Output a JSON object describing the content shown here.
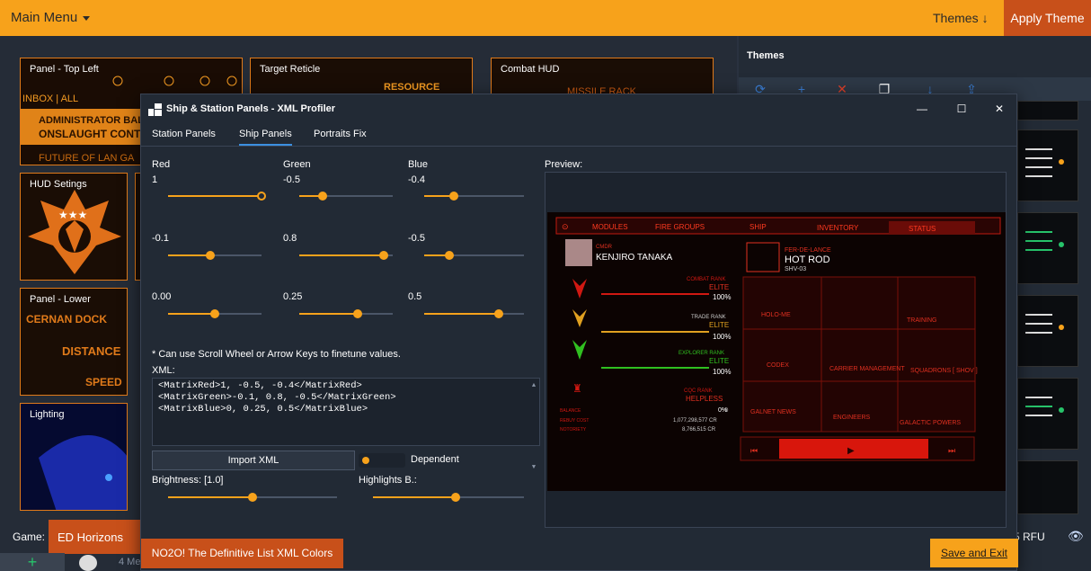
{
  "topbar": {
    "main_menu": "Main Menu",
    "themes": "Themes",
    "apply_theme": "Apply Theme"
  },
  "tiles": [
    {
      "label": "Panel - Top Left",
      "art_text": [
        "INBOX | ALL",
        "ADMINISTRATOR BALDI",
        "ONSLAUGHT CONT",
        "FUTURE OF LAN GA"
      ]
    },
    {
      "label": "Target Reticle",
      "art_text": [
        "RESOURCE"
      ]
    },
    {
      "label": "Combat HUD",
      "art_text": [
        "MISSILE RACK"
      ]
    },
    {
      "label": "HUD Setings"
    },
    {
      "label": "Panel - Lower",
      "art_text": [
        "CERNAN DOCK",
        "DISTANCE",
        "SPEED"
      ]
    },
    {
      "label": "Lighting"
    }
  ],
  "right_panel": {
    "title": "Themes"
  },
  "bottom": {
    "game_label": "Game:",
    "game_value": "ED Horizons",
    "rfu_text": "5 RFU",
    "add_label": "+",
    "mod_text": "4 Me"
  },
  "dialog": {
    "title": "Ship & Station Panels - XML Profiler",
    "tabs": [
      "Station Panels",
      "Ship Panels",
      "Portraits Fix"
    ],
    "active_tab": "Ship Panels",
    "channels": [
      "Red",
      "Green",
      "Blue"
    ],
    "matrix": {
      "red": [
        "1",
        "-0.5",
        "-0.4"
      ],
      "green": [
        "-0.1",
        "0.8",
        "-0.5"
      ],
      "blue": [
        "0.00",
        "0.25",
        "0.5"
      ]
    },
    "matrix_values": {
      "red": [
        1,
        -0.5,
        -0.4
      ],
      "green": [
        -0.1,
        0.8,
        -0.5
      ],
      "blue": [
        0.0,
        0.25,
        0.5
      ]
    },
    "hint": "* Can use Scroll Wheel or Arrow Keys to finetune values.",
    "xml_label": "XML:",
    "xml_lines": [
      "<MatrixRed>1, -0.5, -0.4</MatrixRed>",
      "<MatrixGreen>-0.1, 0.8, -0.5</MatrixGreen>",
      "<MatrixBlue>0, 0.25, 0.5</MatrixBlue>"
    ],
    "import_button": "Import XML",
    "dependent_label": "Dependent",
    "brightness_label": "Brightness: [1.0]",
    "highlights_label": "Highlights B.:",
    "brightness_value": 0.5,
    "highlights_value": 0.55,
    "preview_label": "Preview:",
    "save_button": "Save and Exit",
    "no2o_button": "NO2O! The Definitive List XML Colors"
  },
  "preview": {
    "tabs": [
      "MODULES",
      "FIRE GROUPS",
      "SHIP",
      "INVENTORY",
      "STATUS"
    ],
    "cmdr_label": "CMDR",
    "cmdr_name": "KENJIRO TANAKA",
    "ship_type": "FER-DE-LANCE",
    "ship_name": "HOT ROD",
    "ship_id": "SHV-03",
    "ranks": [
      {
        "label": "COMBAT RANK",
        "value": "ELITE",
        "pct": "100%"
      },
      {
        "label": "TRADE RANK",
        "value": "ELITE",
        "pct": "100%"
      },
      {
        "label": "EXPLORER RANK",
        "value": "ELITE",
        "pct": "100%"
      },
      {
        "label": "CQC RANK",
        "value": "HELPLESS",
        "pct": "0%"
      }
    ],
    "stats": [
      {
        "label": "BALANCE",
        "value": "0"
      },
      {
        "label": "REBUY COST",
        "value": "1,077,298,577 CR"
      },
      {
        "label": "NOTORIETY",
        "value": "8,766,515 CR"
      }
    ],
    "tiles": [
      "HOLO-ME",
      "TRAINING",
      "CODEX",
      "CARRIER MANAGEMENT",
      "SQUADRONS [ SHOV ]",
      "GALNET NEWS",
      "ENGINEERS",
      "GALACTIC POWERS"
    ]
  },
  "colors": {
    "accent": "#f7a21b",
    "danger": "#c8501a",
    "link_blue": "#3b8fe0"
  }
}
